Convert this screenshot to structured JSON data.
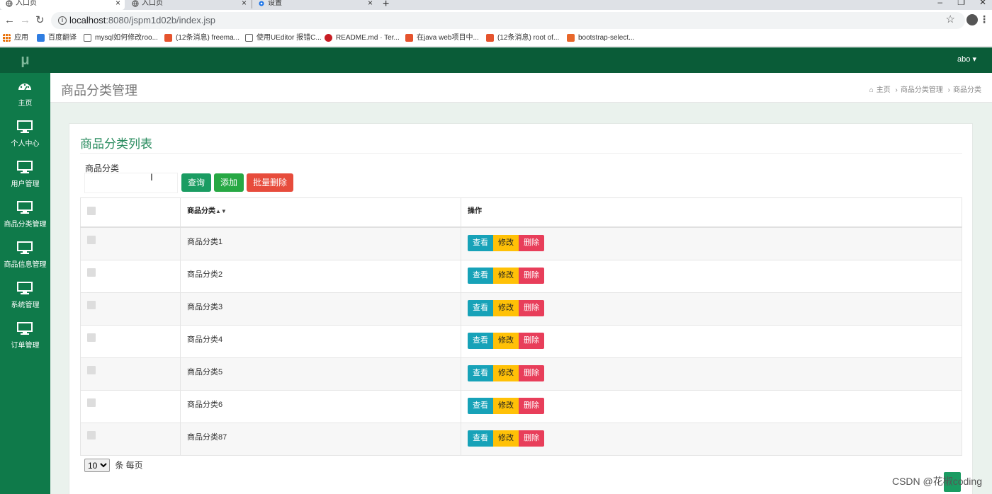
{
  "browser": {
    "tabs": [
      {
        "label": "入口页",
        "active": true
      },
      {
        "label": "入口页",
        "active": false
      },
      {
        "label": "设置",
        "active": false
      }
    ],
    "url_host": "localhost",
    "url_rest": ":8080/jspm1d02b/index.jsp",
    "bookmarks": [
      "应用",
      "百度翻译",
      "mysql如何修改roo...",
      "(12条消息) freema...",
      "使用UEditor 报错C...",
      "README.md · Ter...",
      "在java web项目中...",
      "(12条消息) root of...",
      "bootstrap-select..."
    ]
  },
  "app": {
    "logo": "μ",
    "user": "abo",
    "sidebar": [
      "主页",
      "个人中心",
      "用户管理",
      "商品分类管理",
      "商品信息管理",
      "系统管理",
      "订单管理"
    ]
  },
  "page": {
    "title": "商品分类管理",
    "breadcrumb": [
      "主页",
      "商品分类管理",
      "商品分类"
    ]
  },
  "panel": {
    "title": "商品分类列表",
    "search_label": "商品分类",
    "search_value": "",
    "btn_query": "查询",
    "btn_add": "添加",
    "btn_batch_delete": "批量删除"
  },
  "table": {
    "headers": [
      "",
      "商品分类",
      "操作"
    ],
    "rows": [
      "商品分类1",
      "商品分类2",
      "商品分类3",
      "商品分类4",
      "商品分类5",
      "商品分类6",
      "商品分类87"
    ],
    "actions": {
      "view": "查看",
      "edit": "修改",
      "delete": "删除"
    }
  },
  "pager": {
    "page_size": "10",
    "suffix": "条 每页"
  },
  "watermark": "CSDN @花椒coding",
  "colors": {
    "sidebar": "#0f7a4a",
    "topbar": "#0a5c38",
    "accent": "#2a8c5f",
    "view": "#17a2b8",
    "edit": "#ffc107",
    "delete": "#e83e5a"
  }
}
